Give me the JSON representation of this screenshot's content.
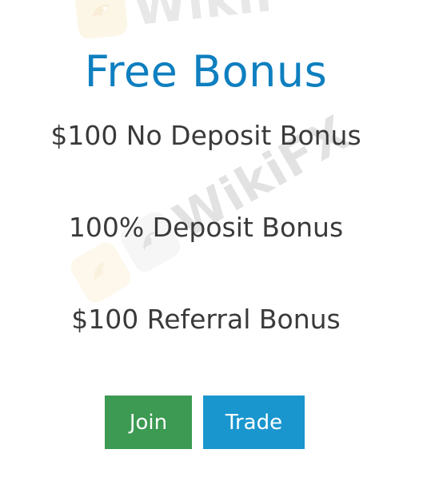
{
  "watermark": {
    "text": "WikiFX",
    "top_text": "WikiF"
  },
  "colors": {
    "title": "#0e7fbf",
    "text": "#3a3a3a",
    "join_button": "#3c9a53",
    "trade_button": "#1a96cf"
  },
  "header": {
    "title": "Free Bonus"
  },
  "bonuses": [
    {
      "label": "$100 No Deposit Bonus"
    },
    {
      "label": "100% Deposit Bonus"
    },
    {
      "label": "$100 Referral Bonus"
    }
  ],
  "actions": {
    "join_label": "Join",
    "trade_label": "Trade"
  },
  "icons": {
    "watermark_logo": "wikifx-eagle-logo-icon"
  }
}
